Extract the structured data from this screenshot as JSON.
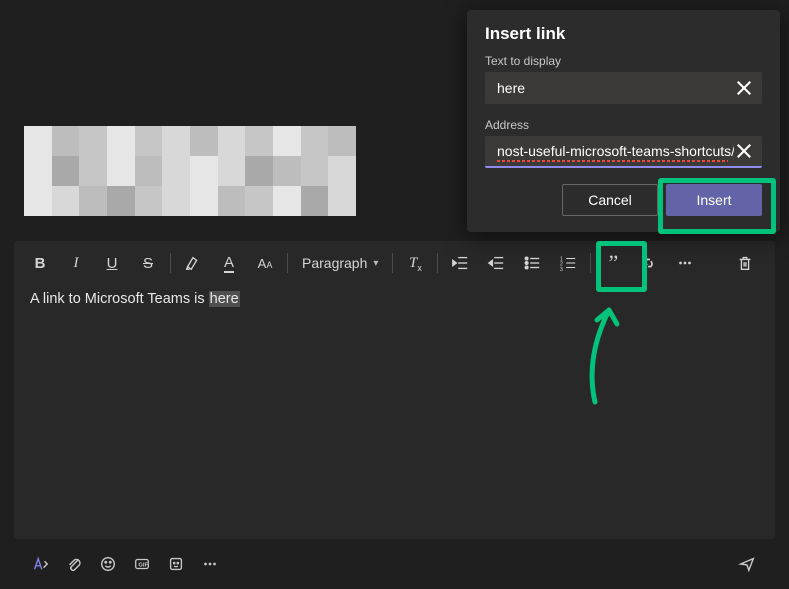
{
  "dialog": {
    "title": "Insert link",
    "text_label": "Text to display",
    "text_value": "here",
    "address_label": "Address",
    "address_value": "nost-useful-microsoft-teams-shortcuts/",
    "cancel_label": "Cancel",
    "insert_label": "Insert"
  },
  "toolbar": {
    "paragraph_label": "Paragraph"
  },
  "editor": {
    "text_before": "A link to Microsoft Teams is ",
    "text_selected": "here"
  }
}
